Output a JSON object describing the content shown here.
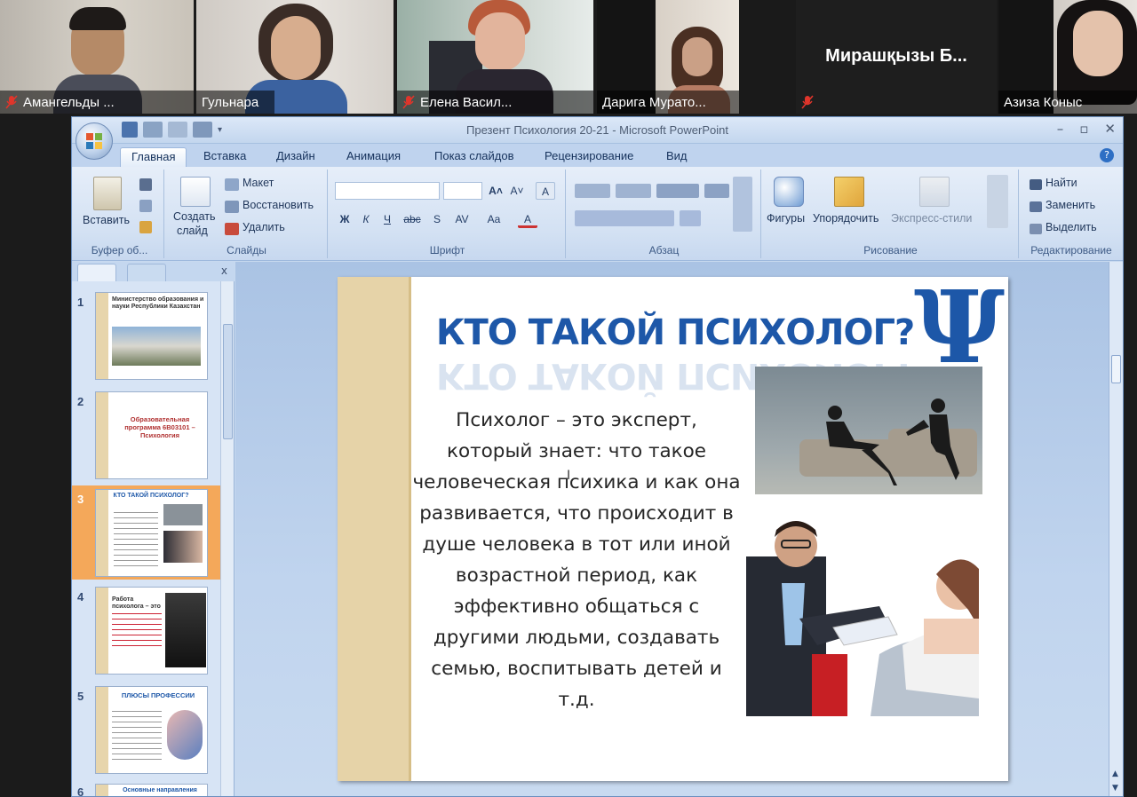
{
  "participants": [
    {
      "name": "Амангельды ...",
      "muted": true
    },
    {
      "name": "Гульнара",
      "muted": false,
      "active": true
    },
    {
      "name": "Елена Васил...",
      "muted": true
    },
    {
      "name": "Дарига Мурато...",
      "muted": false
    },
    {
      "name": "Мирашқызы Б...",
      "muted": true,
      "video": false
    },
    {
      "name": "Азиза Коныс",
      "muted": false
    }
  ],
  "window": {
    "title": "Презент Психология 20-21  -  Microsoft PowerPoint",
    "controls": [
      "–",
      "▫",
      "✕"
    ]
  },
  "ribbon": {
    "tabs": [
      "Главная",
      "Вставка",
      "Дизайн",
      "Анимация",
      "Показ слайдов",
      "Рецензирование",
      "Вид"
    ],
    "selected_tab": "Главная",
    "clipboard": {
      "label": "Буфер об...",
      "paste": "Вставить"
    },
    "slides": {
      "label": "Слайды",
      "new_slide_line1": "Создать",
      "new_slide_line2": "слайд",
      "layout": "Макет",
      "reset": "Восстановить",
      "delete": "Удалить"
    },
    "font": {
      "label": "Шрифт",
      "bold": "Ж",
      "italic": "К",
      "underline": "Ч",
      "strike": "abc",
      "shadow": "S",
      "spacing": "AV",
      "case": "Aa",
      "color": "A"
    },
    "paragraph": {
      "label": "Абзац"
    },
    "drawing": {
      "label": "Рисование",
      "shapes": "Фигуры",
      "arrange": "Упорядочить",
      "quick_styles": "Экспресс-стили"
    },
    "editing": {
      "label": "Редактирование",
      "find": "Найти",
      "replace": "Заменить",
      "select": "Выделить"
    }
  },
  "thumbnails": [
    {
      "num": "1",
      "text": "Министерство образования и науки Республики Казахстан"
    },
    {
      "num": "2",
      "text": "Образовательная программа 6В03101 – Психология"
    },
    {
      "num": "3",
      "text": "КТО ТАКОЙ ПСИХОЛОГ?",
      "selected": true
    },
    {
      "num": "4",
      "text": "Работа психолога – это"
    },
    {
      "num": "5",
      "text": "ПЛЮСЫ ПРОФЕССИИ"
    },
    {
      "num": "6",
      "text": "Основные направления"
    }
  ],
  "slide": {
    "title": "КТО ТАКОЙ ПСИХОЛОГ?",
    "body": "Психолог – это эксперт, который знает:  что такое человеческая психика и как она развивается,  что происходит в душе человека в тот или иной возрастной период, как эффективно общаться с другими людьми, создавать семью, воспитывать детей и т.д.",
    "symbol": "Ψ"
  },
  "colors": {
    "title_blue": "#1d57a8",
    "band_beige": "#e6d3a8",
    "selected_thumb": "#f4a85a",
    "mic_red": "#e0352b"
  }
}
